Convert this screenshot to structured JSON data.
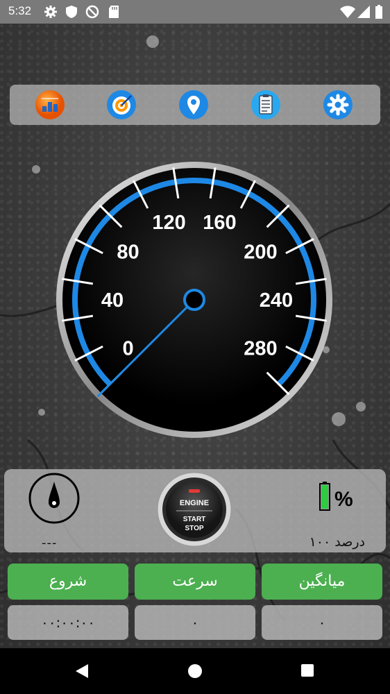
{
  "status_bar": {
    "time": "5:32",
    "left_icons": [
      "gear-icon",
      "shield-icon",
      "vpn-icon",
      "sd-card-icon"
    ],
    "right_icons": [
      "wifi-icon",
      "signal-icon",
      "battery-icon"
    ]
  },
  "toolbar": {
    "buttons": [
      {
        "name": "stats-button",
        "icon": "ranking-icon"
      },
      {
        "name": "target-button",
        "icon": "target-icon"
      },
      {
        "name": "location-button",
        "icon": "location-pin-icon"
      },
      {
        "name": "notes-button",
        "icon": "clipboard-icon"
      },
      {
        "name": "settings-button",
        "icon": "gear-icon"
      }
    ]
  },
  "speedometer": {
    "labels": [
      "0",
      "40",
      "80",
      "120",
      "160",
      "200",
      "240",
      "280"
    ],
    "max": 300,
    "current_speed": 0,
    "accent_color": "#1e88e5"
  },
  "panel": {
    "heading_value": "---",
    "engine_top": "ENGINE",
    "engine_line1": "START",
    "engine_line2": "STOP",
    "battery_symbol": "%",
    "battery_text": "۱۰۰ درصد",
    "battery_level": 1.0,
    "battery_color": "#2ecc40"
  },
  "buttons": {
    "start_label": "شروع",
    "speed_label": "سرعت",
    "average_label": "میانگین"
  },
  "values": {
    "timer": "۰۰:۰۰:۰۰",
    "speed": "۰",
    "average": "۰"
  },
  "colors": {
    "green_button": "#4caf50",
    "accent_blue": "#1e88e5"
  }
}
